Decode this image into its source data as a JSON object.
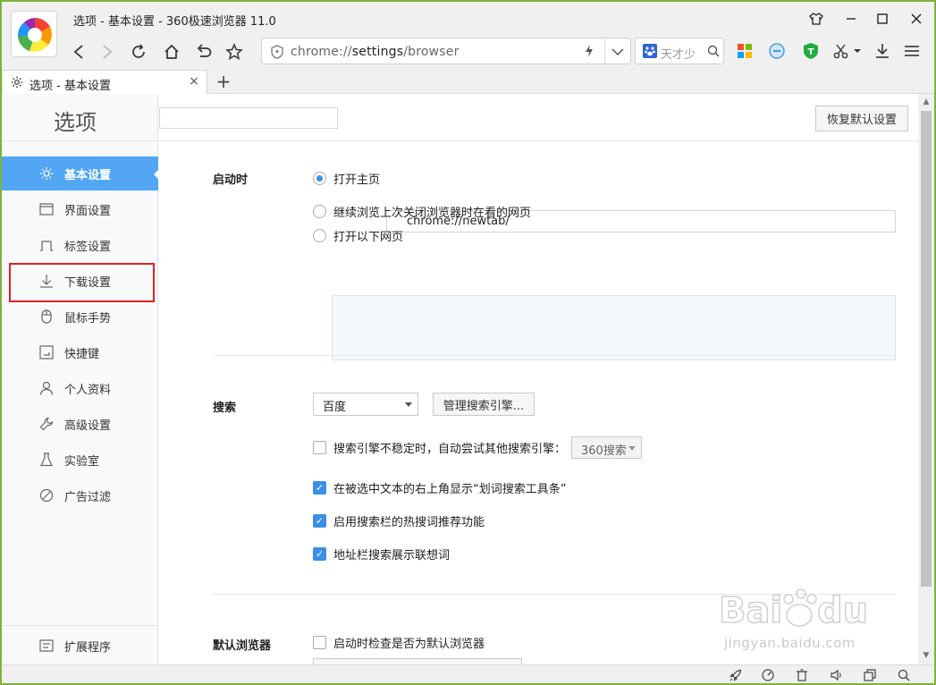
{
  "window": {
    "title": "选项 - 基本设置 - 360极速浏览器 11.0"
  },
  "address": {
    "scheme": "chrome://",
    "host": "settings",
    "path": "/browser"
  },
  "search_engine_box": {
    "placeholder": "天才少"
  },
  "tab": {
    "label": "选项 - 基本设置",
    "close": "×",
    "new_tab": "+"
  },
  "page": {
    "title": "选项",
    "restore_button": "恢复默认设置"
  },
  "sidebar": {
    "items": [
      {
        "label": "基本设置",
        "icon": "sun-icon",
        "active": true
      },
      {
        "label": "界面设置",
        "icon": "window-icon"
      },
      {
        "label": "标签设置",
        "icon": "tab-icon"
      },
      {
        "label": "下载设置",
        "icon": "download-icon"
      },
      {
        "label": "鼠标手势",
        "icon": "mouse-icon"
      },
      {
        "label": "快捷键",
        "icon": "keyboard-icon"
      },
      {
        "label": "个人资料",
        "icon": "person-icon"
      },
      {
        "label": "高级设置",
        "icon": "wrench-icon"
      },
      {
        "label": "实验室",
        "icon": "flask-icon"
      },
      {
        "label": "广告过滤",
        "icon": "block-icon"
      }
    ],
    "extensions": {
      "label": "扩展程序",
      "icon": "extensions-icon"
    }
  },
  "startup": {
    "title": "启动时",
    "open_home": "打开主页",
    "home_url": "chrome://newtab/",
    "continue": "继续浏览上次关闭浏览器时在看的网页",
    "open_pages": "打开以下网页"
  },
  "search": {
    "title": "搜索",
    "engine": "百度",
    "manage_button": "管理搜索引擎...",
    "fallback_label": "搜索引擎不稳定时，自动尝试其他搜索引擎：",
    "fallback_engine": "360搜索",
    "opt_toolbar": "在被选中文本的右上角显示“划词搜索工具条”",
    "opt_hot": "启用搜索栏的热搜词推荐功能",
    "opt_suggest": "地址栏搜索展示联想词"
  },
  "default_browser": {
    "title": "默认浏览器",
    "check_label": "启动时检查是否为默认浏览器"
  },
  "watermark": {
    "url": "jingyan.baidu.com"
  },
  "colors": {
    "accent": "#52a6f3",
    "check": "#3b8fe6",
    "highlight": "#e02020",
    "frame": "#7fb23a"
  }
}
